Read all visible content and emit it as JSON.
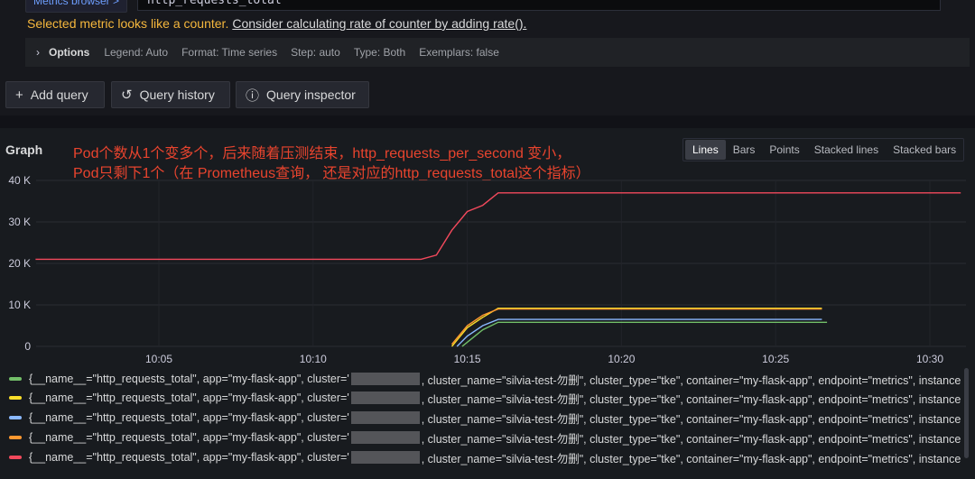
{
  "header": {
    "metrics_browser": "Metrics browser >",
    "query": "http_requests_total",
    "warning_text": "Selected metric looks like a counter.",
    "warning_link": "Consider calculating rate of counter by adding rate()."
  },
  "options": {
    "label": "Options",
    "legend": "Legend: Auto",
    "format": "Format: Time series",
    "step": "Step: auto",
    "type": "Type: Both",
    "exemplars": "Exemplars: false"
  },
  "buttons": {
    "add_query": "Add query",
    "query_history": "Query history",
    "query_inspector": "Query inspector"
  },
  "panel": {
    "title": "Graph",
    "annotation_line1": "Pod个数从1个变多个，后来随着压测结束，http_requests_per_second 变小，",
    "annotation_line2": "Pod只剩下1个（在 Prometheus查询， 还是对应的http_requests_total这个指标）",
    "view_types": [
      "Lines",
      "Bars",
      "Points",
      "Stacked lines",
      "Stacked bars"
    ],
    "active_view": "Lines"
  },
  "chart_data": {
    "type": "line",
    "y_ticks": [
      "40 K",
      "30 K",
      "20 K",
      "10 K",
      "0"
    ],
    "x_ticks": [
      "10:05",
      "10:10",
      "10:15",
      "10:20",
      "10:25",
      "10:30"
    ],
    "ylim": [
      0,
      40000
    ],
    "series": [
      {
        "color": "#f2495c",
        "points": [
          [
            "10:01",
            21000
          ],
          [
            "10:13:30",
            21000
          ],
          [
            "10:14",
            22000
          ],
          [
            "10:14:30",
            28000
          ],
          [
            "10:15",
            32500
          ],
          [
            "10:15:30",
            34000
          ],
          [
            "10:16",
            37000
          ],
          [
            "10:31",
            37000
          ]
        ]
      },
      {
        "color": "#fade2a",
        "points": [
          [
            "10:14:30",
            0
          ],
          [
            "10:15",
            4500
          ],
          [
            "10:15:30",
            7000
          ],
          [
            "10:16",
            9200
          ],
          [
            "10:26:30",
            9200
          ]
        ]
      },
      {
        "color": "#ff9830",
        "points": [
          [
            "10:14:30",
            500
          ],
          [
            "10:15",
            5000
          ],
          [
            "10:15:30",
            7500
          ],
          [
            "10:16",
            9000
          ],
          [
            "10:26:30",
            9000
          ]
        ]
      },
      {
        "color": "#8ab8ff",
        "points": [
          [
            "10:14:40",
            0
          ],
          [
            "10:15",
            2500
          ],
          [
            "10:15:30",
            5000
          ],
          [
            "10:16",
            6500
          ],
          [
            "10:26:30",
            6500
          ]
        ]
      },
      {
        "color": "#73bf69",
        "points": [
          [
            "10:14:50",
            0
          ],
          [
            "10:15:10",
            2000
          ],
          [
            "10:15:30",
            4000
          ],
          [
            "10:16",
            5800
          ],
          [
            "10:26:40",
            5800
          ]
        ]
      }
    ]
  },
  "legend": {
    "rows": [
      {
        "color": "#73bf69",
        "prefix": "{__name__=\"http_requests_total\", app=\"my-flask-app\", cluster='",
        "suffix": ", cluster_name=\"silvia-test-勿删\", cluster_type=\"tke\", container=\"my-flask-app\", endpoint=\"metrics\", instance"
      },
      {
        "color": "#fade2a",
        "prefix": "{__name__=\"http_requests_total\", app=\"my-flask-app\", cluster='",
        "suffix": ", cluster_name=\"silvia-test-勿删\", cluster_type=\"tke\", container=\"my-flask-app\", endpoint=\"metrics\", instance"
      },
      {
        "color": "#8ab8ff",
        "prefix": "{__name__=\"http_requests_total\", app=\"my-flask-app\", cluster='",
        "suffix": ", cluster_name=\"silvia-test-勿删\", cluster_type=\"tke\", container=\"my-flask-app\", endpoint=\"metrics\", instance"
      },
      {
        "color": "#ff9830",
        "prefix": "{__name__=\"http_requests_total\", app=\"my-flask-app\", cluster='",
        "suffix": ", cluster_name=\"silvia-test-勿删\", cluster_type=\"tke\", container=\"my-flask-app\", endpoint=\"metrics\", instance"
      },
      {
        "color": "#f2495c",
        "prefix": "{__name__=\"http_requests_total\", app=\"my-flask-app\", cluster='",
        "suffix": ", cluster_name=\"silvia-test-勿删\", cluster_type=\"tke\", container=\"my-flask-app\", endpoint=\"metrics\", instance"
      }
    ]
  }
}
